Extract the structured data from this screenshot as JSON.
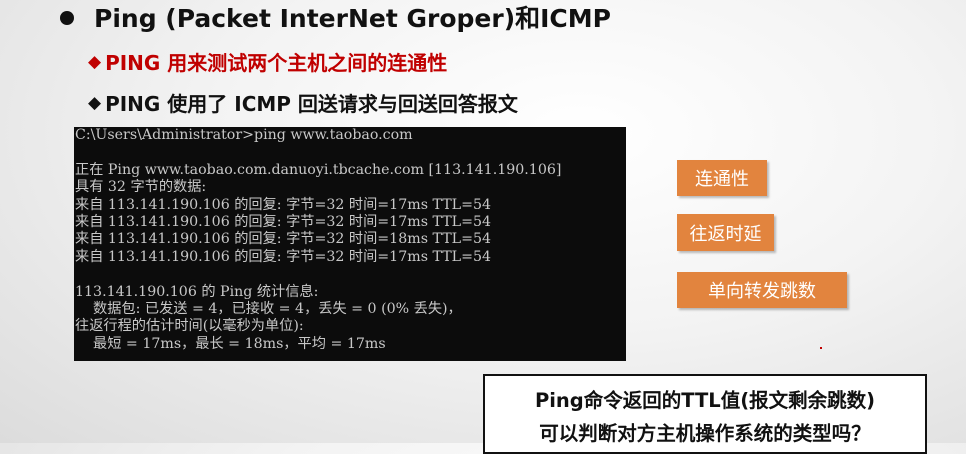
{
  "slide": {
    "title": "Ping (Packet InterNet Groper)和ICMP",
    "bullet_symbol": "◆",
    "subpoints": [
      "PING 用来测试两个主机之间的连通性",
      "PING 使用了 ICMP 回送请求与回送回答报文"
    ]
  },
  "terminal": {
    "lines": [
      "C:\\Users\\Administrator>ping www.taobao.com",
      "",
      "正在 Ping www.taobao.com.danuoyi.tbcache.com [113.141.190.106]",
      "具有 32 字节的数据:",
      "来自 113.141.190.106 的回复: 字节=32 时间=17ms TTL=54",
      "来自 113.141.190.106 的回复: 字节=32 时间=17ms TTL=54",
      "来自 113.141.190.106 的回复: 字节=32 时间=18ms TTL=54",
      "来自 113.141.190.106 的回复: 字节=32 时间=17ms TTL=54",
      "",
      "113.141.190.106 的 Ping 统计信息:",
      "    数据包: 已发送 = 4，已接收 = 4，丢失 = 0 (0% 丢失)，",
      "往返行程的估计时间(以毫秒为单位):",
      "    最短 = 17ms，最长 = 18ms，平均 = 17ms"
    ]
  },
  "tags": [
    "连通性",
    "往返时延",
    "单向转发跳数"
  ],
  "question": {
    "line1": "Ping命令返回的TTL值(报文剩余跳数)",
    "line2": "可以判断对方主机操作系统的类型吗？"
  },
  "colors": {
    "accent_red": "#c00000",
    "tag_orange": "#e2843e",
    "terminal_bg": "#0c0c0c"
  }
}
